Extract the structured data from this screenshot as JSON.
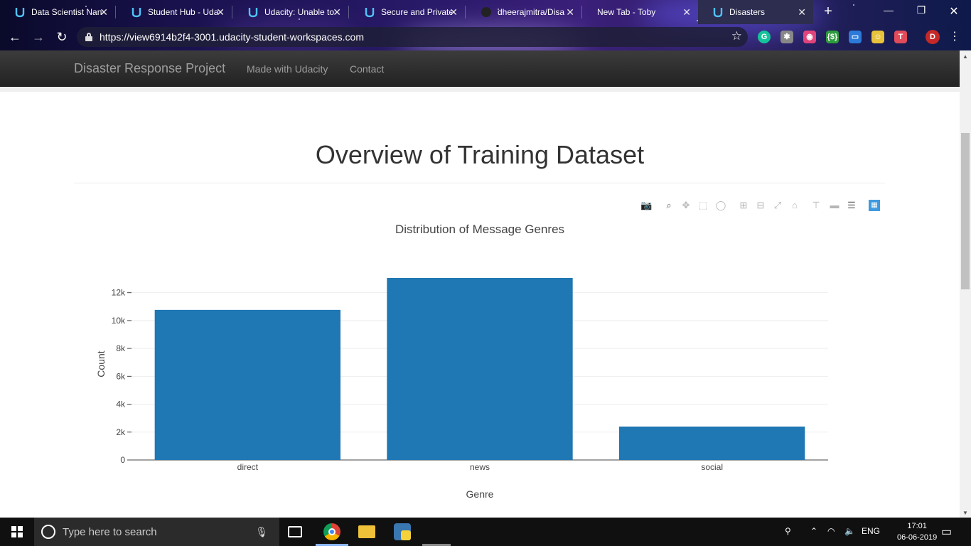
{
  "browser": {
    "tabs": [
      {
        "title": "Data Scientist Nan",
        "favicon": "udacity-icon",
        "active": false
      },
      {
        "title": "Student Hub - Uda",
        "favicon": "udacity-icon",
        "active": false
      },
      {
        "title": "Udacity: Unable to",
        "favicon": "udacity-icon",
        "active": false
      },
      {
        "title": "Secure and Private",
        "favicon": "udacity-icon",
        "active": false
      },
      {
        "title": "dheerajmitra/Disa",
        "favicon": "github-icon",
        "active": false
      },
      {
        "title": "New Tab - Toby",
        "favicon": "none",
        "active": false
      },
      {
        "title": "Disasters",
        "favicon": "udacity-icon",
        "active": true
      }
    ],
    "url": "https://view6914b2f4-3001.udacity-student-workspaces.com",
    "profile_initial": "D",
    "extensions": [
      {
        "name": "grammarly-icon",
        "label": "G",
        "color": "#15c39a"
      },
      {
        "name": "puzzle-icon",
        "label": "✱",
        "color": "#888888"
      },
      {
        "name": "shield-icon",
        "label": "◉",
        "color": "#e0447a"
      },
      {
        "name": "json-icon",
        "label": "{$}",
        "color": "#2d9b3c"
      },
      {
        "name": "toby-icon",
        "label": "▭",
        "color": "#2b7ad9"
      },
      {
        "name": "face-icon",
        "label": "☺",
        "color": "#e8c23a"
      },
      {
        "name": "todoist-icon",
        "label": "T",
        "color": "#e14b5a"
      }
    ]
  },
  "navbar": {
    "brand": "Disaster Response Project",
    "links": [
      "Made with Udacity",
      "Contact"
    ]
  },
  "page": {
    "heading": "Overview of Training Dataset"
  },
  "modebar": {
    "icons": [
      "camera-icon",
      "zoom-icon",
      "pan-icon",
      "box-select-icon",
      "lasso-icon",
      "zoom-in-icon",
      "zoom-out-icon",
      "autoscale-icon",
      "reset-axes-icon",
      "spike-lines-icon",
      "hover-closest-icon",
      "hover-compare-icon",
      "plotly-logo-icon"
    ]
  },
  "chart_data": {
    "type": "bar",
    "title": "Distribution of Message Genres",
    "xlabel": "Genre",
    "ylabel": "Count",
    "categories": [
      "direct",
      "news",
      "social"
    ],
    "values": [
      10766,
      13054,
      2396
    ],
    "ylim": [
      0,
      13054
    ],
    "yticks": [
      0,
      2000,
      4000,
      6000,
      8000,
      10000,
      12000
    ],
    "ytick_labels": [
      "0",
      "2k",
      "4k",
      "6k",
      "8k",
      "10k",
      "12k"
    ],
    "grid": true,
    "bar_color": "#1f77b4"
  },
  "taskbar": {
    "search_placeholder": "Type here to search",
    "language": "ENG",
    "time": "17:01",
    "date": "06-06-2019"
  }
}
